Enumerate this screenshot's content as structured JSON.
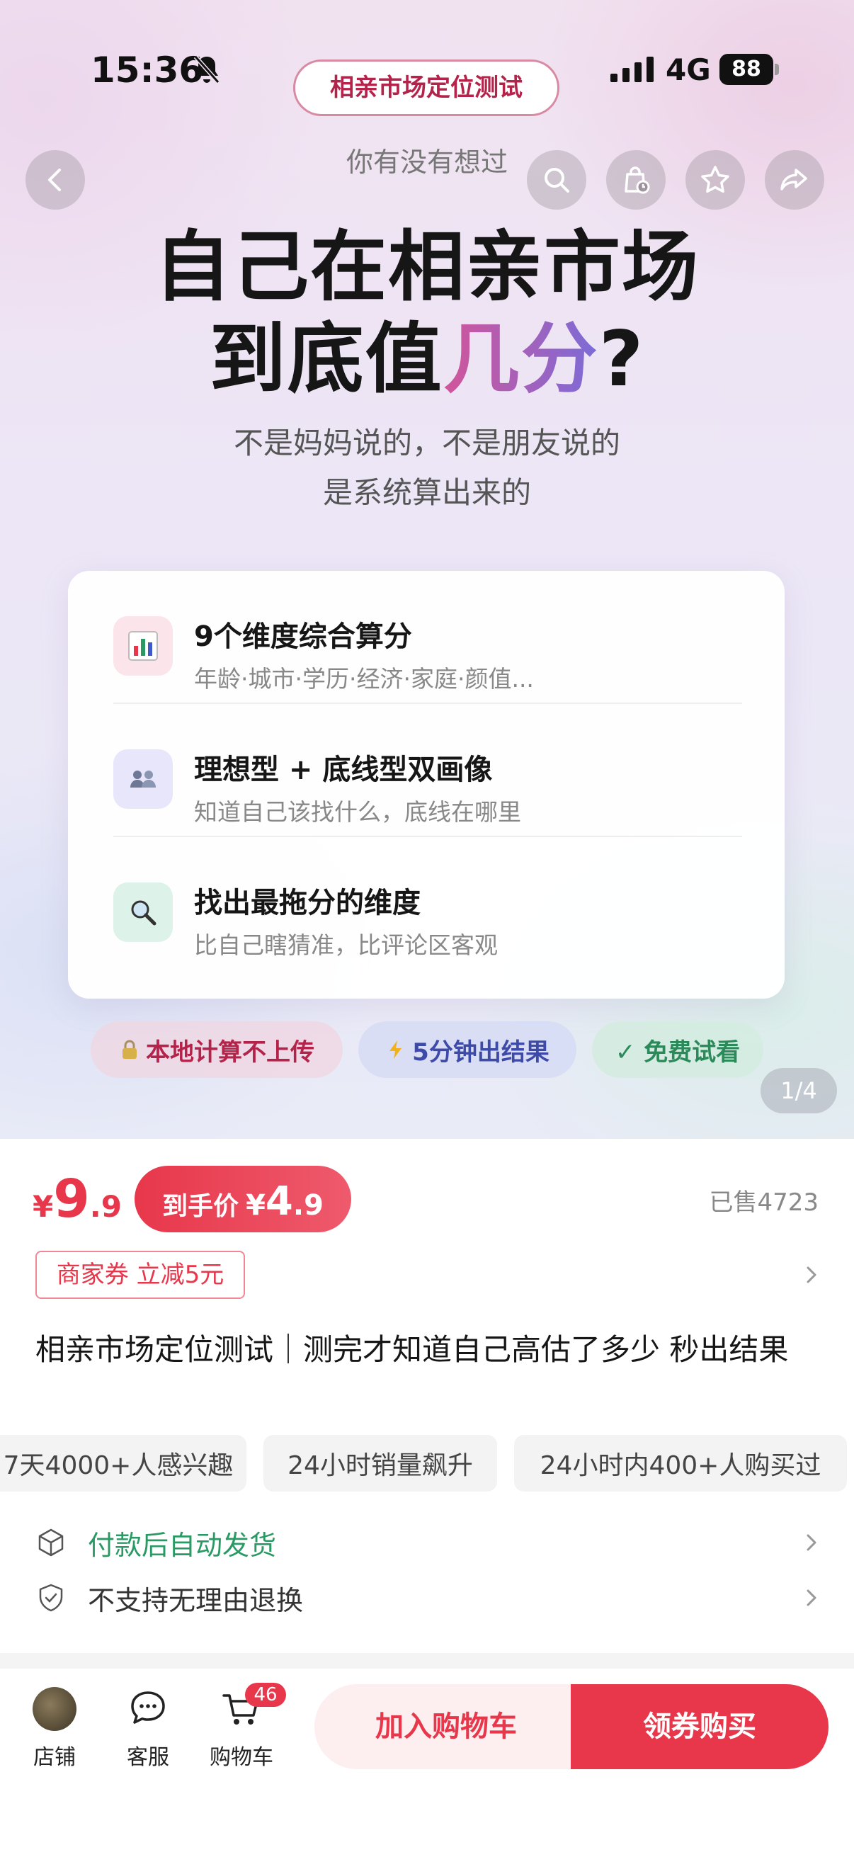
{
  "status_bar": {
    "time": "15:36",
    "network": "4G",
    "battery": "88"
  },
  "header": {
    "title_pill": "相亲市场定位测试"
  },
  "hero": {
    "eyebrow": "你有没有想过",
    "headline_line1": "自己在相亲市场",
    "headline_line2_prefix": "到底值",
    "headline_line2_highlight": "几分",
    "headline_line2_suffix": "?",
    "subtitle_line1": "不是妈妈说的，不是朋友说的",
    "subtitle_line2": "是系统算出来的",
    "features": [
      {
        "icon": "bar-chart-icon",
        "title": "9个维度综合算分",
        "desc": "年龄·城市·学历·经济·家庭·颜值..."
      },
      {
        "icon": "people-icon",
        "title": "理想型 + 底线型双画像",
        "desc": "知道自己该找什么，底线在哪里"
      },
      {
        "icon": "magnifier-icon",
        "title": "找出最拖分的维度",
        "desc": "比自己瞎猜准，比评论区客观"
      }
    ],
    "tags": [
      {
        "icon": "lock-icon",
        "label": "本地计算不上传"
      },
      {
        "icon": "lightning-icon",
        "label": "5分钟出结果"
      },
      {
        "icon": "check-icon",
        "label": "✓ 免费试看"
      }
    ],
    "page_indicator": "1/4"
  },
  "product": {
    "price_currency": "¥",
    "price_int": "9",
    "price_dec": ".9",
    "final_price_label": "到手价",
    "final_price_currency": "¥",
    "final_price_int": "4",
    "final_price_dec": ".9",
    "sold_count": "已售4723",
    "coupon": "商家券 立减5元",
    "title": "相亲市场定位测试｜测完才知道自己高估了多少 秒出结果",
    "hints": [
      "7天4000+人感兴趣",
      "24小时销量飙升",
      "24小时内400+人购买过"
    ],
    "services": [
      {
        "icon": "shipping-box-icon",
        "text": "付款后自动发货"
      },
      {
        "icon": "shield-icon",
        "text": "不支持无理由退换"
      }
    ]
  },
  "bottom_bar": {
    "shop_label": "店铺",
    "service_label": "客服",
    "cart_label": "购物车",
    "cart_badge": "46",
    "add_to_cart": "加入购物车",
    "buy_now": "领券购买"
  },
  "colors": {
    "accent_red": "#e8374b",
    "title_pink": "#b4234a",
    "service_green": "#2a9a65",
    "tag_blue": "#3e4aa8"
  }
}
